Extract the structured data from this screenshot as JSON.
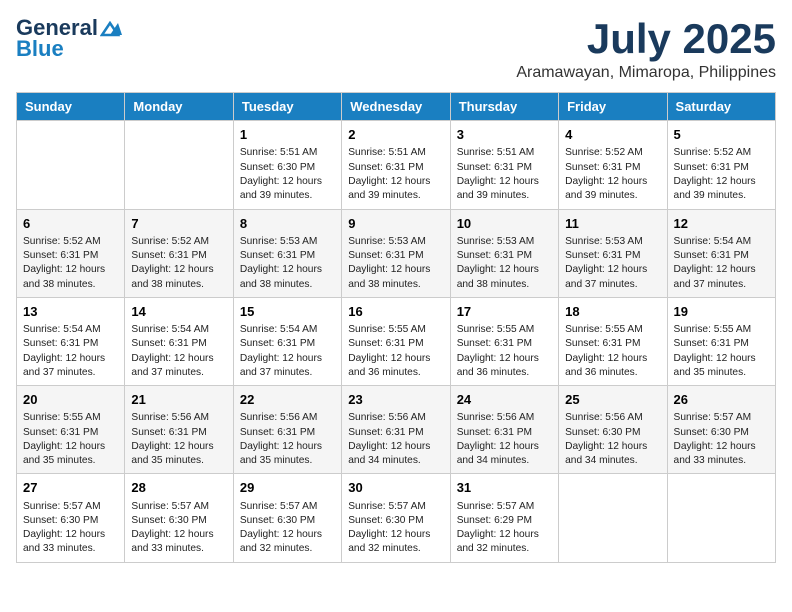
{
  "logo": {
    "line1": "General",
    "line2": "Blue"
  },
  "title": {
    "month": "July 2025",
    "location": "Aramawayan, Mimaropa, Philippines"
  },
  "headers": [
    "Sunday",
    "Monday",
    "Tuesday",
    "Wednesday",
    "Thursday",
    "Friday",
    "Saturday"
  ],
  "weeks": [
    [
      {
        "num": "",
        "info": ""
      },
      {
        "num": "",
        "info": ""
      },
      {
        "num": "1",
        "info": "Sunrise: 5:51 AM\nSunset: 6:30 PM\nDaylight: 12 hours and 39 minutes."
      },
      {
        "num": "2",
        "info": "Sunrise: 5:51 AM\nSunset: 6:31 PM\nDaylight: 12 hours and 39 minutes."
      },
      {
        "num": "3",
        "info": "Sunrise: 5:51 AM\nSunset: 6:31 PM\nDaylight: 12 hours and 39 minutes."
      },
      {
        "num": "4",
        "info": "Sunrise: 5:52 AM\nSunset: 6:31 PM\nDaylight: 12 hours and 39 minutes."
      },
      {
        "num": "5",
        "info": "Sunrise: 5:52 AM\nSunset: 6:31 PM\nDaylight: 12 hours and 39 minutes."
      }
    ],
    [
      {
        "num": "6",
        "info": "Sunrise: 5:52 AM\nSunset: 6:31 PM\nDaylight: 12 hours and 38 minutes."
      },
      {
        "num": "7",
        "info": "Sunrise: 5:52 AM\nSunset: 6:31 PM\nDaylight: 12 hours and 38 minutes."
      },
      {
        "num": "8",
        "info": "Sunrise: 5:53 AM\nSunset: 6:31 PM\nDaylight: 12 hours and 38 minutes."
      },
      {
        "num": "9",
        "info": "Sunrise: 5:53 AM\nSunset: 6:31 PM\nDaylight: 12 hours and 38 minutes."
      },
      {
        "num": "10",
        "info": "Sunrise: 5:53 AM\nSunset: 6:31 PM\nDaylight: 12 hours and 38 minutes."
      },
      {
        "num": "11",
        "info": "Sunrise: 5:53 AM\nSunset: 6:31 PM\nDaylight: 12 hours and 37 minutes."
      },
      {
        "num": "12",
        "info": "Sunrise: 5:54 AM\nSunset: 6:31 PM\nDaylight: 12 hours and 37 minutes."
      }
    ],
    [
      {
        "num": "13",
        "info": "Sunrise: 5:54 AM\nSunset: 6:31 PM\nDaylight: 12 hours and 37 minutes."
      },
      {
        "num": "14",
        "info": "Sunrise: 5:54 AM\nSunset: 6:31 PM\nDaylight: 12 hours and 37 minutes."
      },
      {
        "num": "15",
        "info": "Sunrise: 5:54 AM\nSunset: 6:31 PM\nDaylight: 12 hours and 37 minutes."
      },
      {
        "num": "16",
        "info": "Sunrise: 5:55 AM\nSunset: 6:31 PM\nDaylight: 12 hours and 36 minutes."
      },
      {
        "num": "17",
        "info": "Sunrise: 5:55 AM\nSunset: 6:31 PM\nDaylight: 12 hours and 36 minutes."
      },
      {
        "num": "18",
        "info": "Sunrise: 5:55 AM\nSunset: 6:31 PM\nDaylight: 12 hours and 36 minutes."
      },
      {
        "num": "19",
        "info": "Sunrise: 5:55 AM\nSunset: 6:31 PM\nDaylight: 12 hours and 35 minutes."
      }
    ],
    [
      {
        "num": "20",
        "info": "Sunrise: 5:55 AM\nSunset: 6:31 PM\nDaylight: 12 hours and 35 minutes."
      },
      {
        "num": "21",
        "info": "Sunrise: 5:56 AM\nSunset: 6:31 PM\nDaylight: 12 hours and 35 minutes."
      },
      {
        "num": "22",
        "info": "Sunrise: 5:56 AM\nSunset: 6:31 PM\nDaylight: 12 hours and 35 minutes."
      },
      {
        "num": "23",
        "info": "Sunrise: 5:56 AM\nSunset: 6:31 PM\nDaylight: 12 hours and 34 minutes."
      },
      {
        "num": "24",
        "info": "Sunrise: 5:56 AM\nSunset: 6:31 PM\nDaylight: 12 hours and 34 minutes."
      },
      {
        "num": "25",
        "info": "Sunrise: 5:56 AM\nSunset: 6:30 PM\nDaylight: 12 hours and 34 minutes."
      },
      {
        "num": "26",
        "info": "Sunrise: 5:57 AM\nSunset: 6:30 PM\nDaylight: 12 hours and 33 minutes."
      }
    ],
    [
      {
        "num": "27",
        "info": "Sunrise: 5:57 AM\nSunset: 6:30 PM\nDaylight: 12 hours and 33 minutes."
      },
      {
        "num": "28",
        "info": "Sunrise: 5:57 AM\nSunset: 6:30 PM\nDaylight: 12 hours and 33 minutes."
      },
      {
        "num": "29",
        "info": "Sunrise: 5:57 AM\nSunset: 6:30 PM\nDaylight: 12 hours and 32 minutes."
      },
      {
        "num": "30",
        "info": "Sunrise: 5:57 AM\nSunset: 6:30 PM\nDaylight: 12 hours and 32 minutes."
      },
      {
        "num": "31",
        "info": "Sunrise: 5:57 AM\nSunset: 6:29 PM\nDaylight: 12 hours and 32 minutes."
      },
      {
        "num": "",
        "info": ""
      },
      {
        "num": "",
        "info": ""
      }
    ]
  ]
}
